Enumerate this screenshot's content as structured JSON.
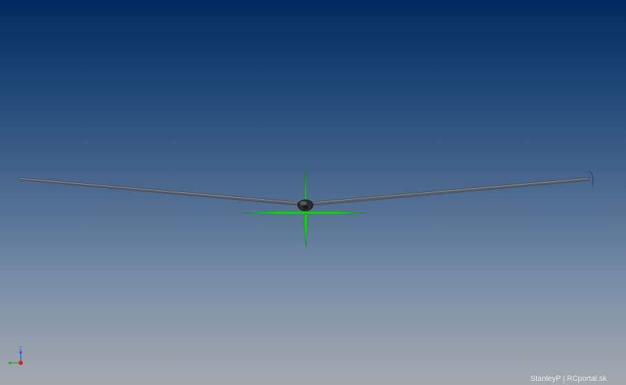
{
  "viewport": {
    "background_top": "#03295f",
    "background_bottom": "#a5a8ae"
  },
  "model": {
    "wing_color": "#5a5e66",
    "wing_highlight": "#9aa0a8",
    "fuselage_color": "#2b2d30",
    "propeller_color": "#22c428"
  },
  "triad": {
    "z_label": "Z",
    "z_color": "#2f5bd8",
    "y_color": "#1fae2a",
    "x_color": "#d81e1e"
  },
  "watermark": {
    "text": "StanleyP | RCportal.sk"
  }
}
